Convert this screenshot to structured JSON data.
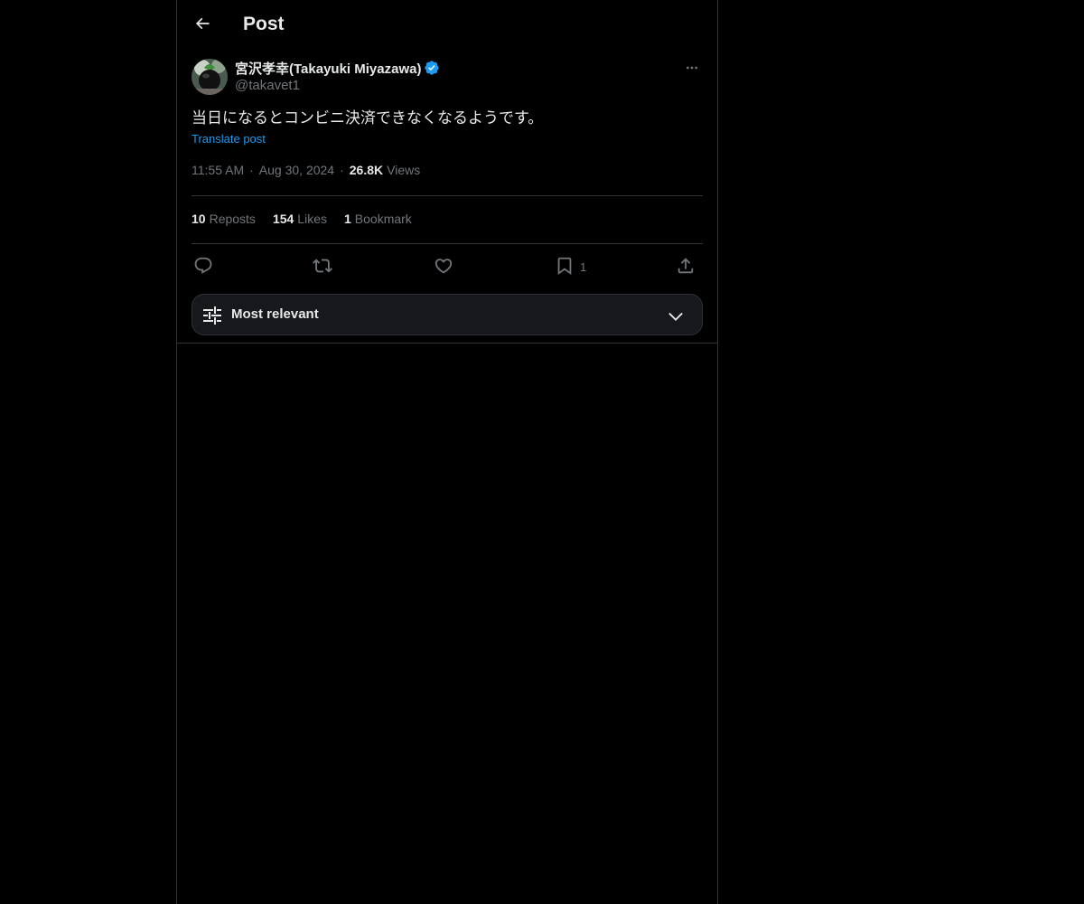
{
  "header": {
    "title": "Post",
    "back_icon": "arrow-left-icon"
  },
  "post": {
    "author": {
      "display_name": "宮沢孝幸(Takayuki Miyazawa)",
      "handle": "@takavet1",
      "verified": true
    },
    "text": "当日になるとコンビニ決済できなくなるようです。",
    "translate_label": "Translate post",
    "time": "11:55 AM",
    "date": "Aug 30, 2024",
    "views_count": "26.8K",
    "views_label": "Views"
  },
  "stats": {
    "reposts_count": "10",
    "reposts_label": "Reposts",
    "likes_count": "154",
    "likes_label": "Likes",
    "bookmarks_count": "1",
    "bookmarks_label": "Bookmark"
  },
  "actions": {
    "bookmark_count": "1",
    "icons": [
      "reply-icon",
      "repost-icon",
      "like-icon",
      "bookmark-icon",
      "share-icon"
    ]
  },
  "sort": {
    "label": "Most relevant"
  },
  "colors": {
    "background": "#000000",
    "text": "#e7e9ea",
    "muted": "#71767b",
    "accent": "#1d9bf0",
    "border": "#2f3336"
  }
}
